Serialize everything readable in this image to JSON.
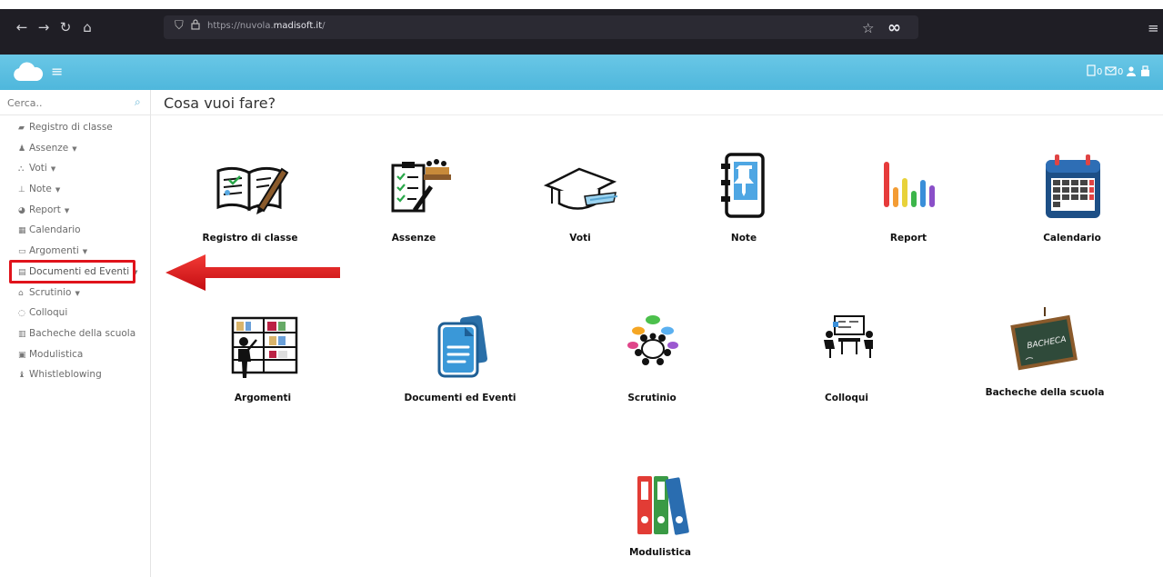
{
  "browser": {
    "url_prefix": "https://nuvola.",
    "url_domain": "madisoft.it",
    "url_suffix": "/"
  },
  "header": {
    "counters": "0 0"
  },
  "sidebar": {
    "search_placeholder": "Cerca..",
    "items": [
      {
        "label": "Registro di classe",
        "icon": "book-icon",
        "caret": false
      },
      {
        "label": "Assenze",
        "icon": "user-icon",
        "caret": true
      },
      {
        "label": "Voti",
        "icon": "bank-icon",
        "caret": true
      },
      {
        "label": "Note",
        "icon": "pin-icon",
        "caret": true
      },
      {
        "label": "Report",
        "icon": "pie-icon",
        "caret": true
      },
      {
        "label": "Calendario",
        "icon": "calendar-icon",
        "caret": false
      },
      {
        "label": "Argomenti",
        "icon": "folder-icon",
        "caret": true
      },
      {
        "label": "Documenti ed Eventi",
        "icon": "archive-icon",
        "caret": true
      },
      {
        "label": "Scrutinio",
        "icon": "graduation-icon",
        "caret": true
      },
      {
        "label": "Colloqui",
        "icon": "chat-icon",
        "caret": false
      },
      {
        "label": "Bacheche della scuola",
        "icon": "board-icon",
        "caret": false
      },
      {
        "label": "Modulistica",
        "icon": "forms-icon",
        "caret": false
      },
      {
        "label": "Whistleblowing",
        "icon": "whistle-icon",
        "caret": false
      }
    ]
  },
  "main": {
    "title": "Cosa vuoi fare?",
    "tiles": [
      {
        "label": "Registro di classe"
      },
      {
        "label": "Assenze"
      },
      {
        "label": "Voti"
      },
      {
        "label": "Note"
      },
      {
        "label": "Report"
      },
      {
        "label": "Calendario"
      },
      {
        "label": "Argomenti"
      },
      {
        "label": "Documenti ed Eventi"
      },
      {
        "label": "Scrutinio"
      },
      {
        "label": "Colloqui"
      },
      {
        "label": "Bacheche della scuola"
      },
      {
        "label": "Modulistica"
      }
    ],
    "bacheca_board_text": "BACHECA"
  },
  "colors": {
    "accent": "#5bbfe1",
    "highlight": "#e0131b",
    "chrome": "#1f1e25"
  }
}
